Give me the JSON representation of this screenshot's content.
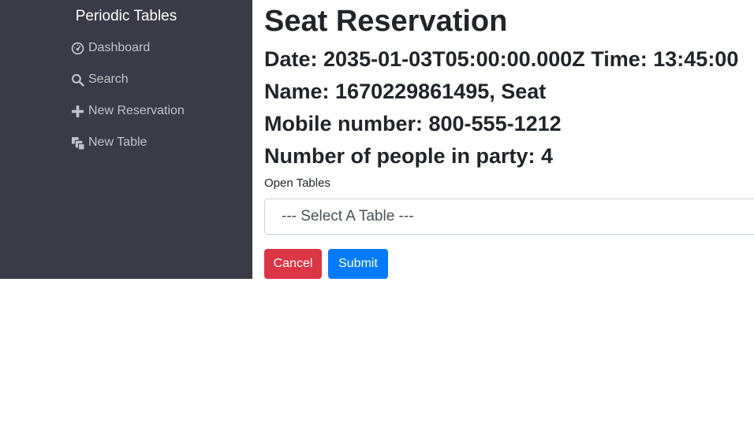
{
  "sidebar": {
    "brand": "Periodic Tables",
    "items": [
      {
        "label": "Dashboard",
        "icon": "dashboard-icon"
      },
      {
        "label": "Search",
        "icon": "search-icon"
      },
      {
        "label": "New Reservation",
        "icon": "plus-icon"
      },
      {
        "label": "New Table",
        "icon": "layers-icon"
      }
    ]
  },
  "main": {
    "title": "Seat Reservation",
    "date_line": "Date: 2035-01-03T05:00:00.000Z Time: 13:45:00",
    "name_line": "Name: 1670229861495, Seat",
    "mobile_line": "Mobile number: 800-555-1212",
    "party_line": "Number of people in party: 4",
    "tables_label": "Open Tables",
    "select_value": "--- Select A Table ---",
    "cancel_label": "Cancel",
    "submit_label": "Submit"
  },
  "colors": {
    "sidebar_bg": "#3a3b47",
    "cancel": "#dc3545",
    "submit": "#007bff"
  }
}
